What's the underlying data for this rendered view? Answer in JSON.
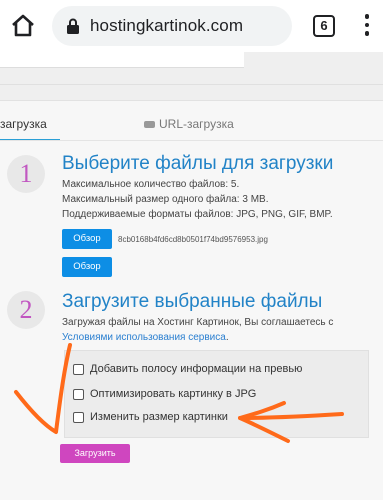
{
  "browser": {
    "url": "hostingkartinok.com",
    "tab_count": "6"
  },
  "tabs": {
    "upload_label": "загрузка",
    "url_label": "URL-загрузка"
  },
  "step1": {
    "number": "1",
    "title": "Выберите файлы для загрузки",
    "info": [
      "Максимальное количество файлов: 5.",
      "Максимальный размер одного файла: 3 MB.",
      "Поддерживаемые форматы файлов: JPG, PNG, GIF, BMP."
    ],
    "browse_label": "Обзор",
    "selected_file": "8cb0168b4fd6cd8b0501f74bd9576953.jpg"
  },
  "step2": {
    "number": "2",
    "title": "Загрузите выбранные файлы",
    "agreement_prefix": "Загружая файлы на Хостинг Картинок, Вы соглашаетесь с",
    "agreement_link": "Условиями использования сервиса",
    "agreement_suffix": "."
  },
  "options": [
    "Добавить полосу информации на превью",
    "Оптимизировать картинку в JPG",
    "Изменить размер картинки"
  ],
  "upload_label": "Загрузить",
  "colors": {
    "accent_blue": "#0d8ee5",
    "title_blue": "#2283c7",
    "step_number": "#c157c1",
    "upload_button": "#cf46bf",
    "annotation": "#ff6a1a"
  }
}
